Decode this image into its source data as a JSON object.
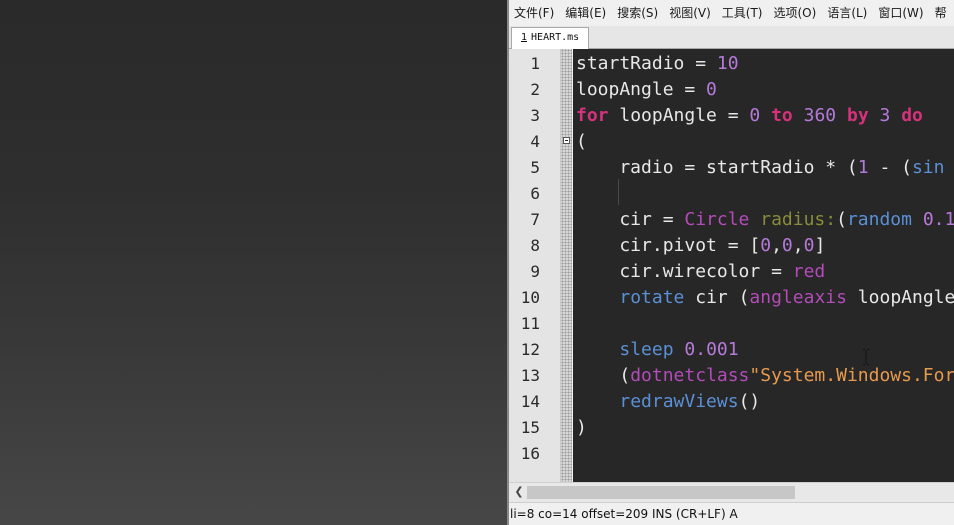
{
  "editor": {
    "menu": [
      "文件(F)",
      "编辑(E)",
      "搜索(S)",
      "视图(V)",
      "工具(T)",
      "选项(O)",
      "语言(L)",
      "窗口(W)",
      "帮"
    ],
    "tab": {
      "number": "1",
      "label": "HEART.ms"
    },
    "line_numbers": [
      "1",
      "2",
      "3",
      "4",
      "5",
      "6",
      "7",
      "8",
      "9",
      "10",
      "11",
      "12",
      "13",
      "14",
      "15",
      "16"
    ],
    "code_lines": [
      [
        {
          "t": "startRadio = ",
          "k": "plain"
        },
        {
          "t": "10",
          "k": "num"
        }
      ],
      [
        {
          "t": "loopAngle = ",
          "k": "plain"
        },
        {
          "t": "0",
          "k": "num"
        }
      ],
      [
        {
          "t": "for",
          "k": "kw"
        },
        {
          "t": " loopAngle = ",
          "k": "plain"
        },
        {
          "t": "0",
          "k": "num"
        },
        {
          "t": " ",
          "k": "plain"
        },
        {
          "t": "to",
          "k": "kw"
        },
        {
          "t": " ",
          "k": "plain"
        },
        {
          "t": "360",
          "k": "num"
        },
        {
          "t": " ",
          "k": "plain"
        },
        {
          "t": "by",
          "k": "kw"
        },
        {
          "t": " ",
          "k": "plain"
        },
        {
          "t": "3",
          "k": "num"
        },
        {
          "t": " ",
          "k": "plain"
        },
        {
          "t": "do",
          "k": "kw"
        }
      ],
      [
        {
          "t": "(",
          "k": "plain"
        }
      ],
      [
        {
          "t": "    radio = startRadio * (",
          "k": "plain"
        },
        {
          "t": "1",
          "k": "num"
        },
        {
          "t": " - (",
          "k": "plain"
        },
        {
          "t": "sin",
          "k": "fn"
        }
      ],
      [
        {
          "t": "",
          "k": "plain"
        }
      ],
      [
        {
          "t": "    cir = ",
          "k": "plain"
        },
        {
          "t": "Circle",
          "k": "cls"
        },
        {
          "t": " ",
          "k": "plain"
        },
        {
          "t": "radius:",
          "k": "param"
        },
        {
          "t": "(",
          "k": "plain"
        },
        {
          "t": "random",
          "k": "fn"
        },
        {
          "t": " ",
          "k": "plain"
        },
        {
          "t": "0.1",
          "k": "num"
        }
      ],
      [
        {
          "t": "    cir.pivot = [",
          "k": "plain"
        },
        {
          "t": "0",
          "k": "num"
        },
        {
          "t": ",",
          "k": "plain"
        },
        {
          "t": "0",
          "k": "num"
        },
        {
          "t": ",",
          "k": "plain"
        },
        {
          "t": "0",
          "k": "num"
        },
        {
          "t": "]",
          "k": "plain"
        }
      ],
      [
        {
          "t": "    cir.wirecolor = ",
          "k": "plain"
        },
        {
          "t": "red",
          "k": "cls"
        }
      ],
      [
        {
          "t": "    ",
          "k": "plain"
        },
        {
          "t": "rotate",
          "k": "fn"
        },
        {
          "t": " cir (",
          "k": "plain"
        },
        {
          "t": "angleaxis",
          "k": "cls"
        },
        {
          "t": " loopAngle",
          "k": "plain"
        }
      ],
      [
        {
          "t": "",
          "k": "plain"
        }
      ],
      [
        {
          "t": "    ",
          "k": "plain"
        },
        {
          "t": "sleep",
          "k": "fn"
        },
        {
          "t": " ",
          "k": "plain"
        },
        {
          "t": "0.001",
          "k": "num"
        }
      ],
      [
        {
          "t": "    (",
          "k": "plain"
        },
        {
          "t": "dotnetclass",
          "k": "cls"
        },
        {
          "t": "\"System.Windows.For",
          "k": "str"
        }
      ],
      [
        {
          "t": "    ",
          "k": "plain"
        },
        {
          "t": "redrawViews",
          "k": "fn"
        },
        {
          "t": "()",
          "k": "plain"
        }
      ],
      [
        {
          "t": ")",
          "k": "plain"
        }
      ],
      [
        {
          "t": "",
          "k": "plain"
        }
      ]
    ],
    "scroll_left_icon": "chevron-left-icon",
    "status": "li=8 co=14 offset=209 INS (CR+LF) A"
  },
  "colors": {
    "code_background": "#272727",
    "keyword": "#d6327c",
    "number": "#b57ad9",
    "function": "#5b8fd6",
    "class": "#b34bb8",
    "parameter": "#898c3a",
    "string": "#e79a4e"
  }
}
